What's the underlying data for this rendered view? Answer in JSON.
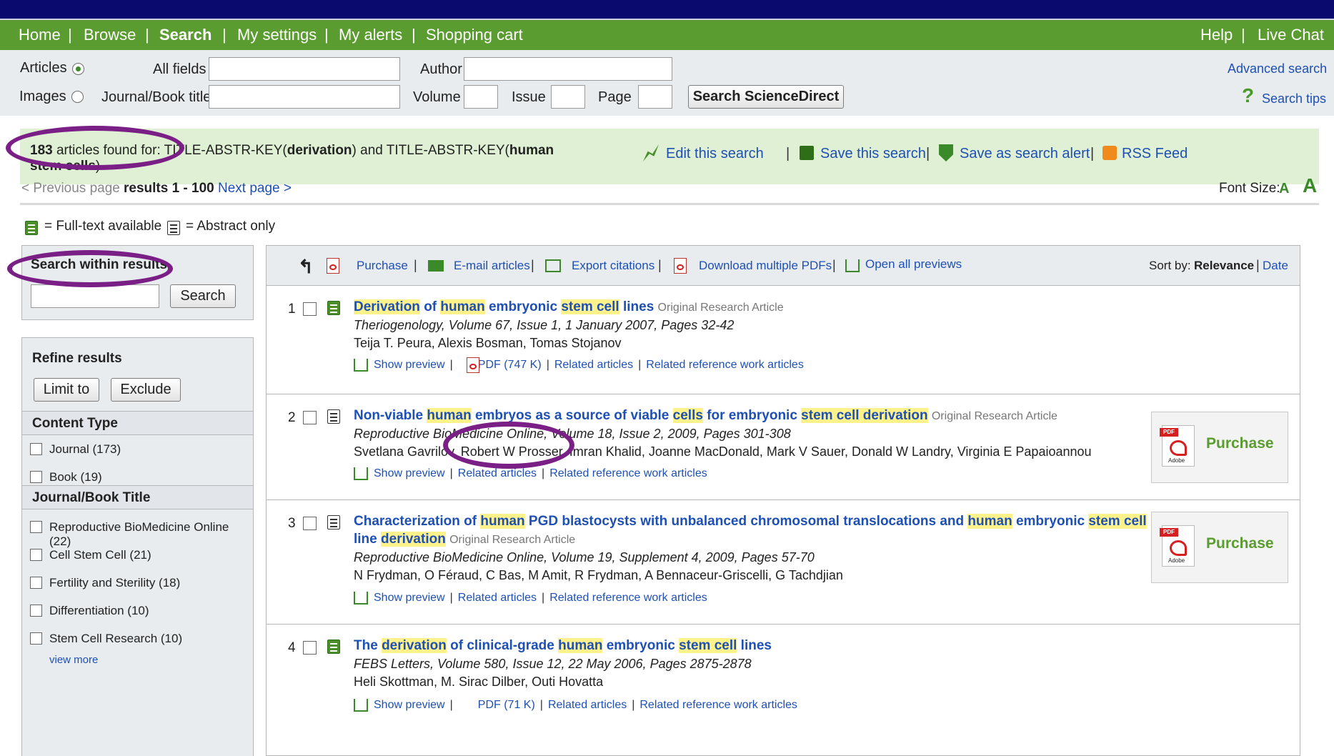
{
  "nav": {
    "left": [
      "Home",
      "Browse",
      "Search",
      "My settings",
      "My alerts",
      "Shopping cart"
    ],
    "right": [
      "Help",
      "Live Chat"
    ],
    "separator": "|"
  },
  "search_form": {
    "articles_label": "Articles",
    "images_label": "Images",
    "all_fields_label": "All fields",
    "journal_label": "Journal/Book title",
    "author_label": "Author",
    "volume_label": "Volume",
    "issue_label": "Issue",
    "page_label": "Page",
    "submit_label": "Search ScienceDirect",
    "advanced_label": "Advanced search",
    "tips_label": "Search tips"
  },
  "results_banner": {
    "count": "183",
    "text_1": " articles found for: TITLE-ABSTR-KEY(",
    "term_1": "derivation",
    "text_2": ") and TITLE-ABSTR-KEY(",
    "term_2": "human stem cells",
    "text_3": ")",
    "edit": "Edit this search",
    "save": "Save this search",
    "alert": "Save as search alert",
    "rss": "RSS Feed"
  },
  "paging": {
    "prev": "< Previous page",
    "range_label": "results 1 - 100",
    "next": "Next page >",
    "font_size": "Font Size:",
    "font_a": "A"
  },
  "legend": {
    "full_text": "= Full-text available",
    "abstract": "= Abstract only"
  },
  "sidebar": {
    "search_within": "Search within results",
    "search_button": "Search",
    "refine": "Refine results",
    "limit": "Limit to",
    "exclude": "Exclude",
    "content_type": "Content Type",
    "content_items": [
      "Journal (173)",
      "Book (19)"
    ],
    "journal_title": "Journal/Book Title",
    "journal_items": [
      "Reproductive BioMedicine Online (22)",
      "Cell Stem Cell (21)",
      "Fertility and Sterility (18)",
      "Differentiation (10)",
      "Stem Cell Research (10)"
    ],
    "view_more": "view more"
  },
  "toolbar": {
    "purchase": "Purchase",
    "email": "E-mail articles",
    "export": "Export citations",
    "download": "Download multiple PDFs",
    "previews": "Open all previews",
    "sort_by": "Sort by:",
    "relevance": "Relevance",
    "date": "Date"
  },
  "articles": [
    {
      "num": "1",
      "t": [
        "Derivation",
        " of ",
        "human",
        " embryonic ",
        "stem cell",
        " lines"
      ],
      "type": "Original Research Article",
      "journal": "Theriogenology, Volume 67, Issue 1, 1 January 2007, Pages 32-42",
      "authors": "Teija T. Peura, Alexis Bosman, Tomas Stojanov",
      "preview": "Show preview",
      "pdf": "PDF (747 K)",
      "related": "Related articles",
      "related_ref": "Related reference work articles"
    },
    {
      "num": "2",
      "t": [
        "Non-viable ",
        "human",
        " embryos as a source of viable ",
        "cells",
        " for embryonic ",
        "stem cell derivation"
      ],
      "type": "Original Research Article",
      "journal": "Reproductive BioMedicine Online, Volume 18, Issue 2, 2009, Pages 301-308",
      "authors": "Svetlana Gavrilov, Robert W Prosser, Imran Khalid, Joanne MacDonald, Mark V Sauer, Donald W Landry, Virginia E Papaioannou",
      "preview": "Show preview",
      "related": "Related articles",
      "related_ref": "Related reference work articles",
      "purchase": "Purchase"
    },
    {
      "num": "3",
      "t": [
        "Characterization of ",
        "human",
        " PGD blastocysts with unbalanced chromosomal translocations and ",
        "human",
        " embryonic ",
        "stem cell"
      ],
      "t2": [
        "line ",
        "derivation"
      ],
      "type": "Original Research Article",
      "journal": "Reproductive BioMedicine Online, Volume 19, Supplement 4, 2009, Pages 57-70",
      "authors": "N Frydman, O Féraud, C Bas, M Amit, R Frydman, A Bennaceur-Griscelli, G Tachdjian",
      "preview": "Show preview",
      "related": "Related articles",
      "related_ref": "Related reference work articles",
      "purchase": "Purchase"
    },
    {
      "num": "4",
      "t": [
        "The ",
        "derivation",
        " of clinical-grade ",
        "human",
        " embryonic ",
        "stem cell",
        " lines"
      ],
      "journal": "FEBS Letters, Volume 580, Issue 12, 22 May 2006, Pages 2875-2878",
      "authors": "Heli Skottman, M. Sirac Dilber, Outi Hovatta",
      "preview": "Show preview",
      "pdf": "PDF (71 K)",
      "related": "Related articles",
      "related_ref": "Related reference work articles"
    }
  ],
  "colors": {
    "nav_green": "#5a9c2f",
    "link_blue": "#1e50b4",
    "highlight": "#fff28a",
    "annotation_oval": "#7a1f86",
    "banner_bg": "#dff0d4"
  }
}
